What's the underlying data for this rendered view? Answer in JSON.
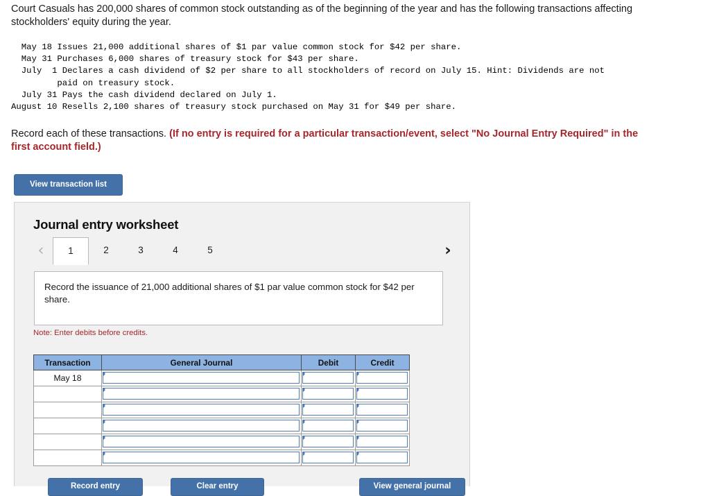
{
  "intro": {
    "text": "Court Casuals has 200,000 shares of common stock outstanding as of the beginning of the year and has the following transactions affecting stockholders' equity during the year."
  },
  "transactions_block": "  May 18 Issues 21,000 additional shares of $1 par value common stock for $42 per share.\n  May 31 Purchases 6,000 shares of treasury stock for $43 per share.\n  July  1 Declares a cash dividend of $2 per share to all stockholders of record on July 15. Hint: Dividends are not\n         paid on treasury stock.\n  July 31 Pays the cash dividend declared on July 1.\nAugust 10 Resells 2,100 shares of treasury stock purchased on May 31 for $49 per share.",
  "record_instruction": {
    "plain": "Record each of these transactions. ",
    "warning": "(If no entry is required for a particular transaction/event, select \"No Journal Entry Required\" in the first account field.)"
  },
  "view_transaction_list_button": "View transaction list",
  "worksheet": {
    "title": "Journal entry worksheet",
    "prev_icon": "‹",
    "next_icon": "›",
    "tabs": [
      {
        "label": "1",
        "active": true
      },
      {
        "label": "2",
        "active": false
      },
      {
        "label": "3",
        "active": false
      },
      {
        "label": "4",
        "active": false
      },
      {
        "label": "5",
        "active": false
      }
    ],
    "description": "Record the issuance of 21,000 additional shares of $1 par value common stock for $42 per share.",
    "note": "Note: Enter debits before credits.",
    "table": {
      "headers": [
        "Transaction",
        "General Journal",
        "Debit",
        "Credit"
      ],
      "rows": [
        {
          "transaction": "May 18",
          "general_journal": "",
          "debit": "",
          "credit": ""
        },
        {
          "transaction": "",
          "general_journal": "",
          "debit": "",
          "credit": ""
        },
        {
          "transaction": "",
          "general_journal": "",
          "debit": "",
          "credit": ""
        },
        {
          "transaction": "",
          "general_journal": "",
          "debit": "",
          "credit": ""
        },
        {
          "transaction": "",
          "general_journal": "",
          "debit": "",
          "credit": ""
        },
        {
          "transaction": "",
          "general_journal": "",
          "debit": "",
          "credit": ""
        }
      ]
    },
    "actions": {
      "record_entry": "Record entry",
      "clear_entry": "Clear entry",
      "view_general_journal": "View general journal"
    }
  },
  "colors": {
    "button_blue": "#4472a8",
    "table_header_blue": "#8db3e2",
    "cell_border_blue": "#4e7ab5",
    "warning_red": "#a5272b",
    "panel_gray": "#f1f1f1"
  }
}
